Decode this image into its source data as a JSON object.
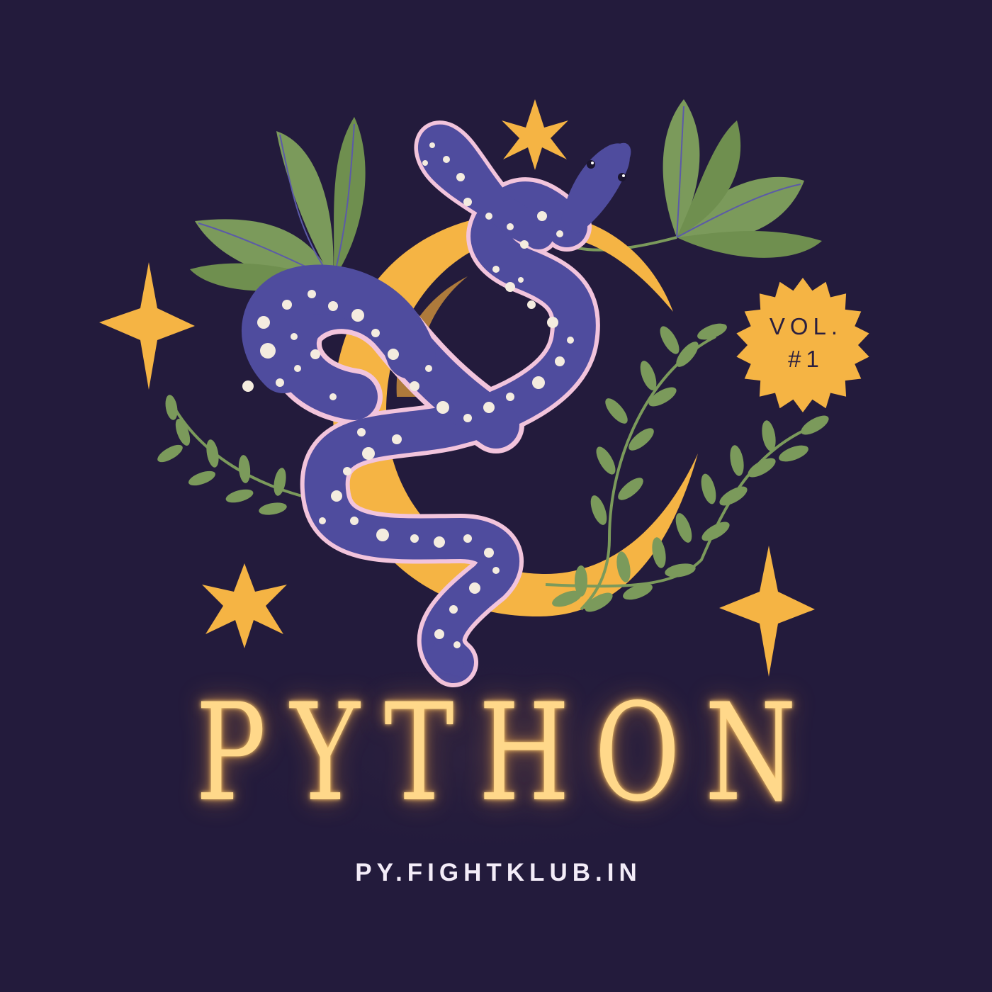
{
  "title": "PYTHON",
  "url": "PY.FIGHTKLUB.IN",
  "badge": {
    "line1": "VOL.",
    "line2": "#1"
  },
  "colors": {
    "background": "#231b3c",
    "moon": "#f5b444",
    "snake": "#4f4c9e",
    "snake_belly": "#f2c4dc",
    "leaf": "#7b9a5b",
    "star": "#f5b444",
    "badge": "#f5b444",
    "title_glow": "#ffd88a",
    "url_text": "#f3ecf8"
  },
  "icons": [
    "crescent-moon",
    "snake",
    "leaf-cluster",
    "vine",
    "four-point-star",
    "six-point-star",
    "starburst-badge"
  ]
}
